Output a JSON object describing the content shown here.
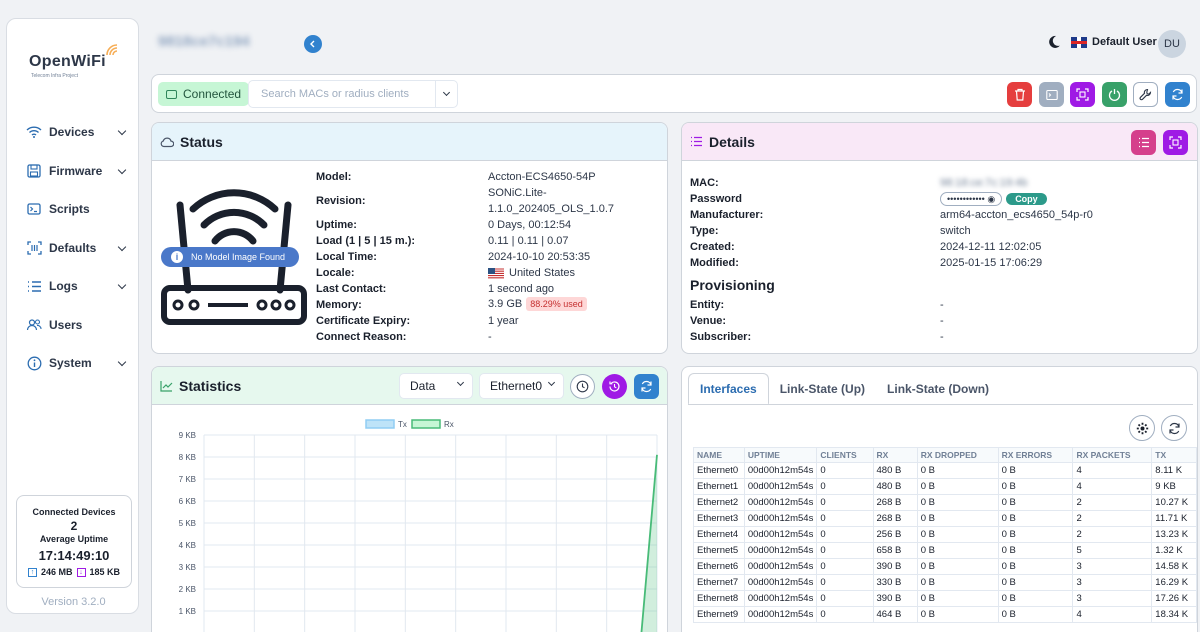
{
  "brand": {
    "name": "OpenWiFi",
    "tagline": "Telecom Infra Project"
  },
  "sidebar": {
    "items": [
      {
        "label": "Devices",
        "icon": "wifi-icon",
        "expandable": true
      },
      {
        "label": "Firmware",
        "icon": "save-icon",
        "expandable": true
      },
      {
        "label": "Scripts",
        "icon": "terminal-icon",
        "expandable": false
      },
      {
        "label": "Defaults",
        "icon": "scan-icon",
        "expandable": true
      },
      {
        "label": "Logs",
        "icon": "list-icon",
        "expandable": true
      },
      {
        "label": "Users",
        "icon": "users-icon",
        "expandable": false
      },
      {
        "label": "System",
        "icon": "info-icon",
        "expandable": true
      }
    ],
    "connected": {
      "title": "Connected Devices",
      "count": "2",
      "avg_label": "Average Uptime",
      "avg_value": "17:14:49:10",
      "tx": "246 MB",
      "rx": "185 KB"
    },
    "version": "Version 3.2.0"
  },
  "header": {
    "serial": "9818ce7c194",
    "user_name": "Default User",
    "user_initials": "DU"
  },
  "toolbar": {
    "connected_label": "Connected",
    "search_placeholder": "Search MACs or radius clients"
  },
  "status": {
    "title": "Status",
    "no_image": "No Model Image Found",
    "labels": {
      "model": "Model:",
      "revision": "Revision:",
      "uptime": "Uptime:",
      "load": "Load (1 | 5 | 15 m.):",
      "local_time": "Local Time:",
      "locale": "Locale:",
      "last_contact": "Last Contact:",
      "memory": "Memory:",
      "cert_expiry": "Certificate Expiry:",
      "connect_reason": "Connect Reason:"
    },
    "values": {
      "model": "Accton-ECS4650-54P",
      "revision_1": "SONiC.Lite-",
      "revision_2": "1.1.0_202405_OLS_1.0.7",
      "uptime": "0 Days, 00:12:54",
      "load": "0.11 | 0.11 | 0.07",
      "local_time": "2024-10-10 20:53:35",
      "locale": "United States",
      "last_contact": "1 second ago",
      "memory": "3.9 GB",
      "memory_used": "88.29% used",
      "cert_expiry": "1 year",
      "connect_reason": "-"
    }
  },
  "details": {
    "title": "Details",
    "labels": {
      "mac": "MAC:",
      "password": "Password",
      "manufacturer": "Manufacturer:",
      "type": "Type:",
      "created": "Created:",
      "modified": "Modified:"
    },
    "values": {
      "mac": "98:18:ce:7c:19:4b",
      "password": "••••••••••••",
      "copy": "Copy",
      "manufacturer": "arm64-accton_ecs4650_54p-r0",
      "type": "switch",
      "created": "2024-12-11 12:02:05",
      "modified": "2025-01-15 17:06:29"
    },
    "provisioning": {
      "title": "Provisioning",
      "entity_label": "Entity:",
      "entity": "-",
      "venue_label": "Venue:",
      "venue": "-",
      "subscriber_label": "Subscriber:",
      "subscriber": "-"
    }
  },
  "statistics": {
    "title": "Statistics",
    "metric": "Data",
    "interface": "Ethernet0"
  },
  "chart_data": {
    "type": "line",
    "series": [
      {
        "name": "Tx",
        "color": "#90cdf4",
        "values": [
          0,
          0,
          0,
          0,
          0,
          0,
          0,
          0,
          0,
          0,
          0,
          0,
          0,
          0,
          0,
          0,
          0,
          0,
          0,
          0,
          0,
          0,
          0,
          0,
          0,
          0,
          0,
          0,
          0,
          0
        ]
      },
      {
        "name": "Rx",
        "color": "#48bb78",
        "values": [
          0,
          0,
          0,
          0,
          0,
          0,
          0,
          0,
          0,
          0,
          0,
          0,
          0,
          0,
          0,
          0,
          0,
          0,
          0,
          0,
          0,
          0,
          0,
          0,
          0,
          0,
          0,
          0,
          0,
          8.1
        ]
      }
    ],
    "y_ticks": [
      "9 KB",
      "8 KB",
      "7 KB",
      "6 KB",
      "5 KB",
      "4 KB",
      "3 KB",
      "2 KB",
      "1 KB"
    ],
    "ylim": [
      0,
      9
    ],
    "grid": true,
    "legend": "top-center"
  },
  "interfaces": {
    "tabs": [
      "Interfaces",
      "Link-State (Up)",
      "Link-State (Down)"
    ],
    "columns": [
      "NAME",
      "UPTIME",
      "CLIENTS",
      "RX",
      "RX DROPPED",
      "RX ERRORS",
      "RX PACKETS",
      "TX"
    ],
    "rows": [
      [
        "Ethernet0",
        "00d00h12m54s",
        "0",
        "480 B",
        "0 B",
        "0 B",
        "4",
        "8.11 K"
      ],
      [
        "Ethernet1",
        "00d00h12m54s",
        "0",
        "480 B",
        "0 B",
        "0 B",
        "4",
        "9 KB"
      ],
      [
        "Ethernet2",
        "00d00h12m54s",
        "0",
        "268 B",
        "0 B",
        "0 B",
        "2",
        "10.27 K"
      ],
      [
        "Ethernet3",
        "00d00h12m54s",
        "0",
        "268 B",
        "0 B",
        "0 B",
        "2",
        "11.71 K"
      ],
      [
        "Ethernet4",
        "00d00h12m54s",
        "0",
        "256 B",
        "0 B",
        "0 B",
        "2",
        "13.23 K"
      ],
      [
        "Ethernet5",
        "00d00h12m54s",
        "0",
        "658 B",
        "0 B",
        "0 B",
        "5",
        "1.32 K"
      ],
      [
        "Ethernet6",
        "00d00h12m54s",
        "0",
        "390 B",
        "0 B",
        "0 B",
        "3",
        "14.58 K"
      ],
      [
        "Ethernet7",
        "00d00h12m54s",
        "0",
        "330 B",
        "0 B",
        "0 B",
        "3",
        "16.29 K"
      ],
      [
        "Ethernet8",
        "00d00h12m54s",
        "0",
        "390 B",
        "0 B",
        "0 B",
        "3",
        "17.26 K"
      ],
      [
        "Ethernet9",
        "00d00h12m54s",
        "0",
        "464 B",
        "0 B",
        "0 B",
        "4",
        "18.34 K"
      ]
    ]
  },
  "colors": {
    "delete": "#e53e3e",
    "terminal": "#a0aec0",
    "scan": "#9f1ae5",
    "power": "#38a169",
    "refresh": "#3182ce",
    "pink": "#d53f8c"
  }
}
